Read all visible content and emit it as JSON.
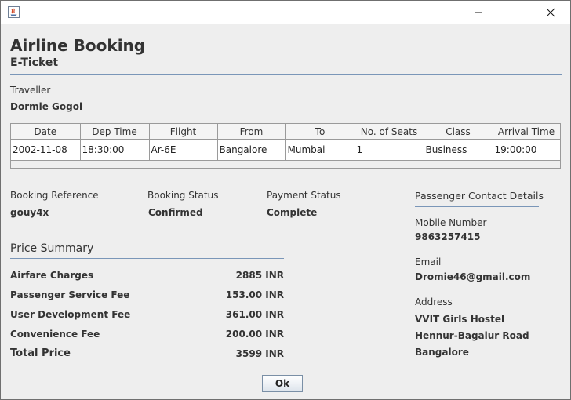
{
  "window": {
    "icon": "java-app-icon",
    "controls": {
      "minimize": "minimize-icon",
      "maximize": "maximize-icon",
      "close": "close-icon"
    }
  },
  "header": {
    "title": "Airline Booking",
    "subtitle": "E-Ticket"
  },
  "traveller": {
    "label": "Traveller",
    "name": "Dormie Gogoi"
  },
  "flight_table": {
    "columns": [
      "Date",
      "Dep Time",
      "Flight",
      "From",
      "To",
      "No. of Seats",
      "Class",
      "Arrival Time"
    ],
    "rows": [
      [
        "2002-11-08",
        "18:30:00",
        "Ar-6E",
        "Bangalore",
        "Mumbai",
        "1",
        "Business",
        "19:00:00"
      ]
    ]
  },
  "booking": {
    "reference_label": "Booking Reference",
    "reference_value": "gouy4x",
    "status_label": "Booking Status",
    "status_value": "Confirmed",
    "payment_label": "Payment Status",
    "payment_value": "Complete"
  },
  "price_summary": {
    "title": "Price Summary",
    "items": [
      {
        "label": "Airfare Charges",
        "value": "2885 INR"
      },
      {
        "label": "Passenger Service Fee",
        "value": "153.00 INR"
      },
      {
        "label": "User Development Fee",
        "value": "361.00 INR"
      },
      {
        "label": "Convenience Fee",
        "value": "200.00 INR"
      },
      {
        "label": "Total Price",
        "value": "3599 INR"
      }
    ]
  },
  "contact": {
    "title": "Passenger Contact Details",
    "mobile_label": "Mobile Number",
    "mobile_value": "9863257415",
    "email_label": "Email",
    "email_value": "Dromie46@gmail.com",
    "address_label": "Address",
    "address_lines": [
      "VVIT Girls Hostel",
      "Hennur-Bagalur Road",
      "Bangalore"
    ]
  },
  "ok_button": {
    "label": "Ok"
  },
  "colors": {
    "separator": "#7a96b8",
    "background": "#eeeeee"
  }
}
